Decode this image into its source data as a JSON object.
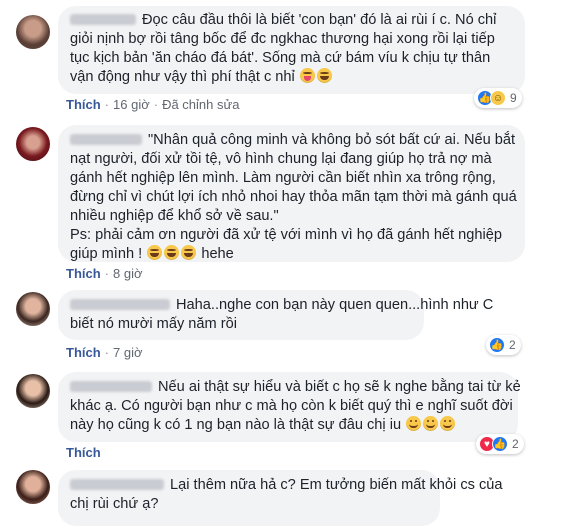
{
  "colors": {
    "bubble": "#f2f3f5",
    "link": "#385898",
    "meta": "#606770",
    "like_blue": "#2078f4",
    "love_red": "#f0284a",
    "haha_yellow": "#f7c84a"
  },
  "comments": [
    {
      "author": "Thu Hà Đặng",
      "lines": [
        "Đọc câu đầu thôi là biết 'con bạn' đó là ai rùi í c. Nó chỉ",
        "giỏi nịnh bợ rồi tâng bốc để đc ngkhac thương hại xong rồi lại tiếp",
        "tục kịch bản 'ăn cháo đá bát'. Sống mà cứ bám víu k chịu tự thân",
        "vận động như vậy thì phí thật c nhỉ"
      ],
      "like_label": "Thích",
      "time": "16 giờ",
      "edited": "Đã chỉnh sửa",
      "reaction_count": "9",
      "reactions": [
        "like",
        "haha"
      ]
    },
    {
      "author": "Nhàn Vũ",
      "lines": [
        "\"Nhân quả công minh và không bỏ sót bất cứ ai. Nếu bắt",
        "nạt người, đối xử tồi tệ, vô hình chung lại đang giúp họ trả nợ mà",
        "gánh hết nghiệp lên mình. Làm người cần biết nhìn xa trông rộng,",
        "đừng chỉ vì chút lợi ích nhỏ nhoi hay thỏa mãn tạm thời mà gánh quá",
        "nhiều nghiệp để khổ sở về sau.\"",
        "Ps: phải cảm ơn người đã xử tệ với mình vì họ đã gánh hết nghiệp",
        "giúp mình !",
        "hehe"
      ],
      "like_label": "Thích",
      "time": "8 giờ"
    },
    {
      "author": "Linh Nguyễn",
      "lines": [
        "Haha..nghe con bạn này quen quen...hình như C",
        "biết nó mười mấy năm rồi"
      ],
      "like_label": "Thích",
      "time": "7 giờ",
      "reaction_count": "2",
      "reactions": [
        "like"
      ]
    },
    {
      "author": "Quỳnh Anh",
      "lines": [
        "Nếu ai thật sự hiểu và biết c họ sẽ k nghe bằng tai từ kẻ",
        "khác ạ. Có người bạn như c mà họ còn k biết quý thì e nghĩ suốt đời",
        "này họ cũng k có 1 ng bạn nào là thật sự đâu chị iu"
      ],
      "like_label": "Thích",
      "time": "",
      "reaction_count": "2",
      "reactions": [
        "love",
        "like"
      ]
    },
    {
      "author": "Mai Trang",
      "lines": [
        "Lại thêm nữa hả c? Em tưởng biến mất khỏi cs của",
        "chị rùi chứ ạ?"
      ]
    }
  ]
}
